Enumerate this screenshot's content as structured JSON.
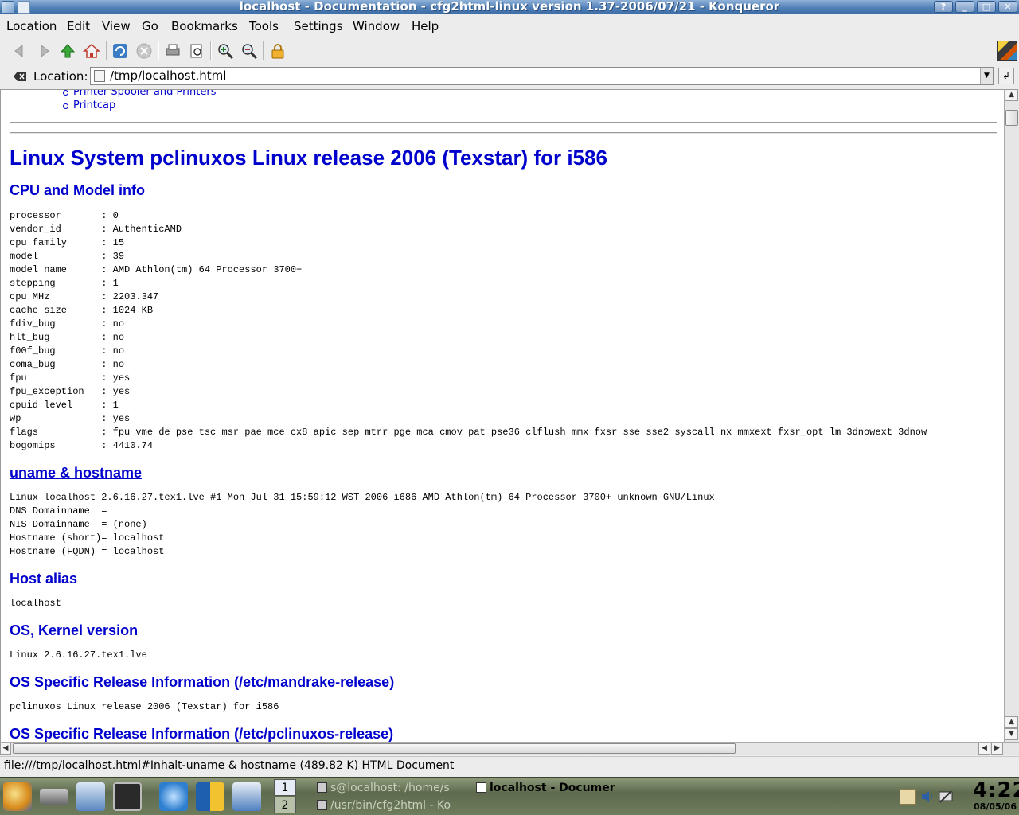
{
  "window": {
    "title": "localhost - Documentation - cfg2html-linux version 1.37-2006/07/21 - Konqueror",
    "buttons": [
      "?",
      "_",
      "□",
      "✕"
    ]
  },
  "menu": {
    "items": [
      "Location",
      "Edit",
      "View",
      "Go",
      "Bookmarks",
      "Tools",
      "Settings",
      "Window",
      "Help"
    ]
  },
  "toolbar": {
    "icons": [
      "back-icon",
      "forward-icon",
      "up-icon",
      "home-icon",
      "reload-icon",
      "stop-icon",
      "print-icon",
      "print-preview-icon",
      "zoom-in-icon",
      "zoom-out-icon",
      "security-lock-icon"
    ]
  },
  "location": {
    "label": "Location:",
    "url": "/tmp/localhost.html"
  },
  "content": {
    "toc_items": [
      "Printer Spooler and Printers",
      "Printcap"
    ],
    "main_title": "Linux System pclinuxos Linux release 2006 (Texstar) for i586",
    "sections": [
      {
        "heading": "CPU and Model info",
        "body": "processor       : 0\nvendor_id       : AuthenticAMD\ncpu family      : 15\nmodel           : 39\nmodel name      : AMD Athlon(tm) 64 Processor 3700+\nstepping        : 1\ncpu MHz         : 2203.347\ncache size      : 1024 KB\nfdiv_bug        : no\nhlt_bug         : no\nf00f_bug        : no\ncoma_bug        : no\nfpu             : yes\nfpu_exception   : yes\ncpuid level     : 1\nwp              : yes\nflags           : fpu vme de pse tsc msr pae mce cx8 apic sep mtrr pge mca cmov pat pse36 clflush mmx fxsr sse sse2 syscall nx mmxext fxsr_opt lm 3dnowext 3dnow\nbogomips        : 4410.74"
      },
      {
        "heading": "uname & hostname",
        "body": "Linux localhost 2.6.16.27.tex1.lve #1 Mon Jul 31 15:59:12 WST 2006 i686 AMD Athlon(tm) 64 Processor 3700+ unknown GNU/Linux\nDNS Domainname  =\nNIS Domainname  = (none)\nHostname (short)= localhost\nHostname (FQDN) = localhost"
      },
      {
        "heading": "Host alias",
        "body": "localhost"
      },
      {
        "heading": "OS, Kernel version",
        "body": "Linux 2.6.16.27.tex1.lve"
      },
      {
        "heading": "OS Specific Release Information (/etc/mandrake-release)",
        "body": "pclinuxos Linux release 2006 (Texstar) for i586"
      },
      {
        "heading": "OS Specific Release Information (/etc/pclinuxos-release)",
        "body": ""
      }
    ]
  },
  "status": {
    "text": "file:///tmp/localhost.html#Inhalt-uname & hostname (489.82 K) HTML Document"
  },
  "taskbar": {
    "pager": [
      "1",
      "2"
    ],
    "tasks": [
      "s@localhost: /home/s",
      "/usr/bin/cfg2html - Ko",
      "localhost - Documer"
    ],
    "clock_time": "4:22",
    "clock_date": "08/05/06"
  },
  "colors": {
    "link": "#0000cc",
    "titlebar": "#4f7fb6"
  }
}
